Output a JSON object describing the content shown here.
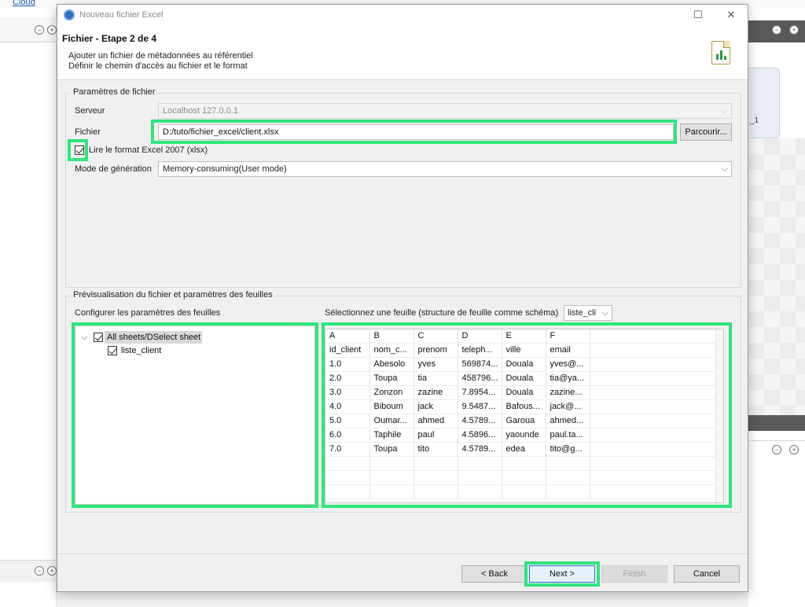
{
  "ide": {
    "cloud_link": "Cloud",
    "right_card_label": "_1"
  },
  "dialog": {
    "title": "Nouveau fichier Excel",
    "header": {
      "title": "Fichier - Etape 2 de 4",
      "desc1": "Ajouter un fichier de métadonnées au référentiel",
      "desc2": "Définir le chemin d'accès au fichier et le format"
    },
    "params": {
      "group_label": "Paramètres de fichier",
      "server_label": "Serveur",
      "server_value": "Localhost 127.0.0.1",
      "file_label": "Fichier",
      "file_value": "D:/tuto/fichier_excel/client.xlsx",
      "browse_label": "Parcourir...",
      "excel2007_label": "Lire le format Excel 2007 (xlsx)",
      "mode_label": "Mode de génération",
      "mode_value": "Memory-consuming(User mode)"
    },
    "preview": {
      "group_label": "Prévisualisation du fichier et paramètres des feuilles",
      "sheets_label": "Configurer les paramètres des feuilles",
      "tree_all": "All sheets/DSelect sheet",
      "tree_sheet": "liste_client",
      "select_sheet_label": "Sélectionnez une feuille (structure de feuille comme schéma)",
      "sheet_combo_value": "liste_cli",
      "columns": [
        "A",
        "B",
        "C",
        "D",
        "E",
        "F"
      ],
      "rows": [
        [
          "id_client",
          "nom_c...",
          "prenom",
          "teleph...",
          "ville",
          "email"
        ],
        [
          "1.0",
          "Abesolo",
          "yves",
          "569874...",
          "Douala",
          "yves@..."
        ],
        [
          "2.0",
          "Toupa",
          "tia",
          "458796...",
          "Douala",
          "tia@ya..."
        ],
        [
          "3.0",
          "Zonzon",
          "zazine",
          "7.8954...",
          "Douala",
          "zazine..."
        ],
        [
          "4.0",
          "Biboum",
          "jack",
          "9.5487...",
          "Bafous...",
          "jack@..."
        ],
        [
          "5.0",
          "Oumar...",
          "ahmed",
          "4.5789...",
          "Garoua",
          "ahmed..."
        ],
        [
          "6.0",
          "Taphile",
          "paul",
          "4.5896...",
          "yaounde",
          "paul.ta..."
        ],
        [
          "7.0",
          "Toupa",
          "tito",
          "4.5789...",
          "edea",
          "tito@g..."
        ]
      ]
    },
    "footer": {
      "back": "< Back",
      "next": "Next >",
      "finish": "Finish",
      "cancel": "Cancel"
    },
    "colors": {
      "highlight": "#2ee67a",
      "primary_border": "#1e6fd0"
    }
  }
}
